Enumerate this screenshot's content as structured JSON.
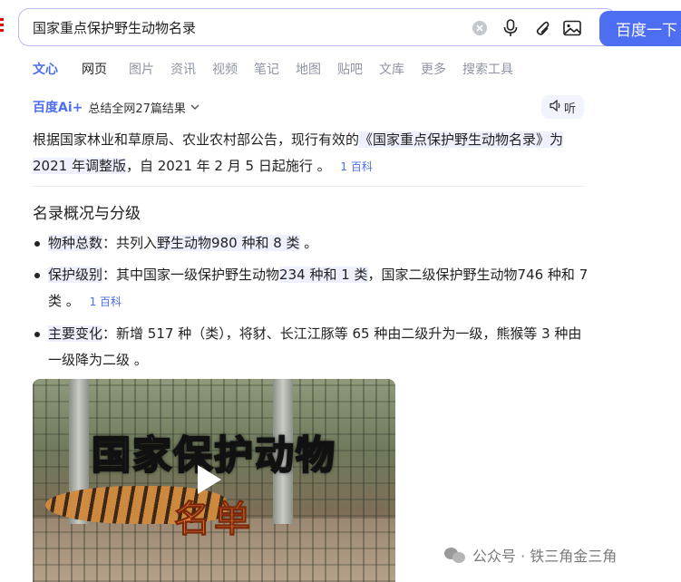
{
  "search": {
    "query": "国家重点保护野生动物名录",
    "button_label": "百度一下"
  },
  "tabs": [
    {
      "label": "文心"
    },
    {
      "label": "网页"
    },
    {
      "label": "图片"
    },
    {
      "label": "资讯"
    },
    {
      "label": "视频"
    },
    {
      "label": "笔记"
    },
    {
      "label": "地图"
    },
    {
      "label": "贴吧"
    },
    {
      "label": "文库"
    },
    {
      "label": "更多"
    },
    {
      "label": "搜索工具"
    }
  ],
  "ai": {
    "logo": "百度Ai+",
    "summary": "总结全网27篇结果",
    "listen_label": "听"
  },
  "answer": {
    "p1_a": "根据国家林业和草原局、农业农村部公告，现行有效的",
    "p1_b": "《国家重点保护野生动物名录》为 2021 年调整版",
    "p1_c": "，自 2021 年 2 月 5 日起施行 。",
    "cite_num": "1",
    "cite_src": "百科"
  },
  "section": {
    "title": "名录概况与分级",
    "items": [
      {
        "key": "物种总数",
        "sep": "：",
        "text_a": "共列入",
        "text_hl": "野生动物980 种和 8 类",
        "text_b": " 。"
      },
      {
        "key": "保护级别",
        "sep": "：",
        "text_a": "其中国家一级保护野生动物",
        "text_hl": "234 种和 1 类",
        "text_b": "，国家二级保护野生动物746 种和 7 类 。",
        "cite_num": "1",
        "cite_src": "百科"
      },
      {
        "key": "主要变化",
        "sep": "：",
        "text_a": "新增 517 种（类），将豺、长江江豚等 65 种由二级升为一级，熊猴等 3 种由一级降为二级 。"
      }
    ]
  },
  "video": {
    "title_line1": "国家保护动物",
    "title_line2": "名单"
  },
  "watermark": {
    "text": "公众号 · 铁三角金三角"
  },
  "colors": {
    "accent": "#4e6ef2",
    "highlight": "#eef0fd",
    "title_orange": "#f07a3a"
  }
}
